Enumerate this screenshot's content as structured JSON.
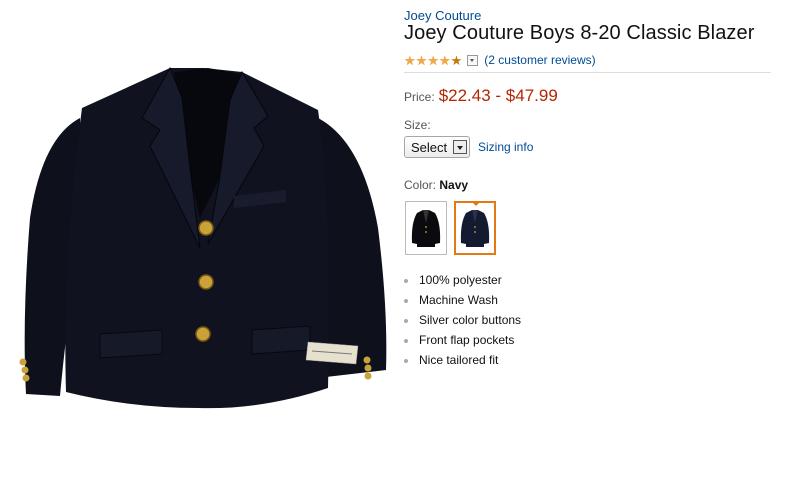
{
  "product": {
    "brand": "Joey Couture",
    "title": "Joey Couture Boys 8-20 Classic Blazer",
    "rating": 4.5,
    "reviews_label": "(2 customer reviews)",
    "price_label": "Price:",
    "price": "$22.43 - $47.99",
    "size_label": "Size:",
    "size_selected": "Select",
    "sizing_info": "Sizing info",
    "color_label": "Color:",
    "color_selected": "Navy",
    "swatches": [
      "black",
      "navy"
    ],
    "features": [
      "100% polyester",
      "Machine Wash",
      "Silver color buttons",
      "Front flap pockets",
      "Nice tailored fit"
    ]
  },
  "colors": {
    "link": "#004b91",
    "price": "#b12704",
    "star": "#f3a847",
    "selected_swatch": "#e47911",
    "jacket": "#0f1220"
  },
  "icons": {
    "rating_dropdown": "chevron-down-icon",
    "select_arrow": "dropdown-arrow-icon"
  }
}
